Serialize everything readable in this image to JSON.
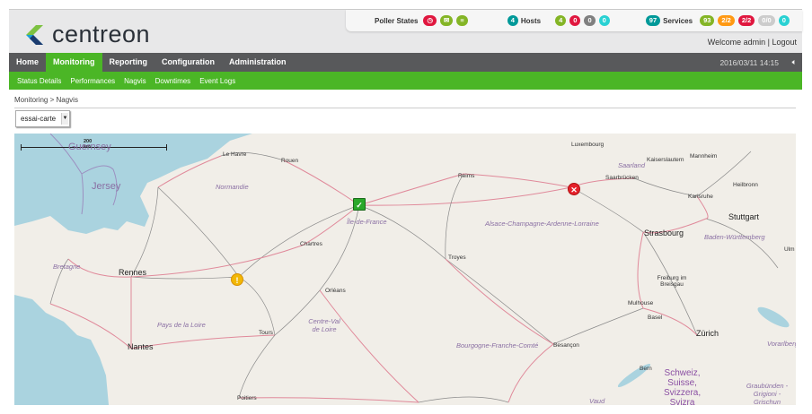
{
  "header": {
    "logo_text": "centreon",
    "poller_label": "Poller States",
    "poller_icons": [
      {
        "icon": "clock-icon",
        "color": "#e0173f"
      },
      {
        "icon": "inbox-icon",
        "color": "#84b526"
      },
      {
        "icon": "database-icon",
        "color": "#84b526"
      }
    ],
    "hosts": {
      "total": "4",
      "label": "Hosts",
      "up": "4",
      "down": "0",
      "unreachable": "0",
      "pending": "0"
    },
    "services": {
      "total": "97",
      "label": "Services",
      "ok": "93",
      "warning": "2/2",
      "critical": "2/2",
      "unknown": "0/0",
      "pending": "0"
    },
    "welcome": "Welcome admin",
    "logout": "Logout",
    "colors": {
      "teal": "#009999",
      "green": "#84b526",
      "red": "#e0173f",
      "gray": "#808080",
      "cyan": "#29d1d3",
      "orange": "#ff9913",
      "lightgray": "#cccccc"
    }
  },
  "nav": {
    "items": [
      "Home",
      "Monitoring",
      "Reporting",
      "Configuration",
      "Administration"
    ],
    "active": "Monitoring",
    "datetime": "2016/03/11 14:15"
  },
  "subnav": {
    "items": [
      "Status Details",
      "Performances",
      "Nagvis",
      "Downtimes",
      "Event Logs"
    ]
  },
  "breadcrumb": {
    "parent": "Monitoring",
    "separator": ">",
    "current": "Nagvis"
  },
  "map_select": {
    "value": "essai-carte"
  },
  "map": {
    "scale": "200 km",
    "islands": [
      "Guernsey",
      "Jersey"
    ],
    "cities": [
      "Le Havre",
      "Rouen",
      "Reims",
      "Luxembourg",
      "Kaiserslautern",
      "Mannheim",
      "Saarbrücken",
      "Heilbronn",
      "Karlsruhe",
      "Stuttgart",
      "Strasbourg",
      "Chartres",
      "Rennes",
      "Orléans",
      "Troyes",
      "Nantes",
      "Tours",
      "Poitiers",
      "Besançon",
      "Mulhouse",
      "Basel",
      "Freiburg im Breisgau",
      "Zürich",
      "Bern",
      "Ulm"
    ],
    "regions": [
      "Normandie",
      "Bretagne",
      "Île-de-France",
      "Pays de la Loire",
      "Centre-Val de Loire",
      "Alsace-Champagne-Ardenne-Lorraine",
      "Bourgogne-Franche-Comté",
      "Saarland",
      "Baden-Württemberg",
      "Vorarlberg",
      "Vaud",
      "Graubünden - Grigioni - Grischun"
    ],
    "country_label": [
      "Schweiz,",
      "Suisse,",
      "Svizzera,",
      "Svizra"
    ],
    "markers": [
      {
        "status": "ok",
        "color": "#2aa82a"
      },
      {
        "status": "warning",
        "color": "#f2b705"
      },
      {
        "status": "critical",
        "color": "#e5212b"
      }
    ]
  }
}
